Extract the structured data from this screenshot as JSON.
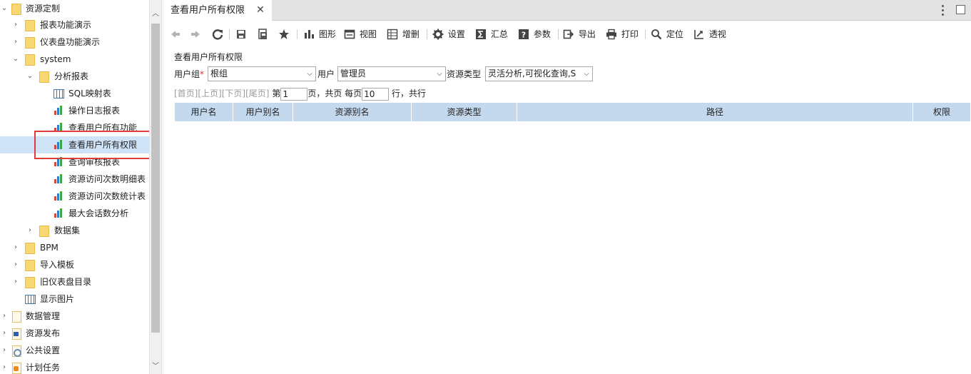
{
  "tree": {
    "items": [
      {
        "label": "资源定制",
        "icon": "folder-icon",
        "expanded": true
      },
      {
        "label": "报表功能演示",
        "icon": "folder-icon",
        "expanded": false
      },
      {
        "label": "仪表盘功能演示",
        "icon": "folder-icon",
        "expanded": false
      },
      {
        "label": "system",
        "icon": "folder-icon",
        "expanded": true
      },
      {
        "label": "分析报表",
        "icon": "folder-icon",
        "expanded": true
      },
      {
        "label": "SQL映射表",
        "icon": "grid-icon"
      },
      {
        "label": "操作日志报表",
        "icon": "bar-chart-icon"
      },
      {
        "label": "查看用户所有功能",
        "icon": "bar-chart-icon"
      },
      {
        "label": "查看用户所有权限",
        "icon": "bar-chart-icon",
        "selected": true
      },
      {
        "label": "查询审核报表",
        "icon": "bar-chart-icon"
      },
      {
        "label": "资源访问次数明细表",
        "icon": "bar-chart-icon"
      },
      {
        "label": "资源访问次数统计表",
        "icon": "bar-chart-icon"
      },
      {
        "label": "最大会话数分析",
        "icon": "bar-chart-icon"
      },
      {
        "label": "数据集",
        "icon": "folder-icon",
        "expanded": false
      },
      {
        "label": "BPM",
        "icon": "folder-icon",
        "expanded": false
      },
      {
        "label": "导入模板",
        "icon": "folder-icon",
        "expanded": false
      },
      {
        "label": "旧仪表盘目录",
        "icon": "folder-icon",
        "expanded": false
      },
      {
        "label": "显示图片",
        "icon": "grid-icon"
      },
      {
        "label": "数据管理",
        "icon": "page-icon",
        "expanded": false
      },
      {
        "label": "资源发布",
        "icon": "page-publish-icon",
        "expanded": false
      },
      {
        "label": "公共设置",
        "icon": "page-settings-icon",
        "expanded": false
      },
      {
        "label": "计划任务",
        "icon": "page-schedule-icon",
        "expanded": false
      }
    ]
  },
  "tab": {
    "title": "查看用户所有权限",
    "close": "✕"
  },
  "toolbar": {
    "chart": "图形",
    "view": "视图",
    "add_delete": "增删",
    "settings": "设置",
    "summary": "汇总",
    "params": "参数",
    "export": "导出",
    "print": "打印",
    "locate": "定位",
    "pivot": "透视"
  },
  "form": {
    "title": "查看用户所有权限",
    "group_label": "用户组",
    "required_mark": "*",
    "group_value": "根组",
    "user_label": "用户",
    "user_value": "管理员",
    "type_label": "资源类型",
    "type_value": "灵活分析,可视化查询,S"
  },
  "pager": {
    "first": "[首页]",
    "prev": "[上页]",
    "next": "[下页]",
    "last": "[尾页]",
    "page_prefix": "第",
    "page_value": "1",
    "page_suffix": "页，共页 每页",
    "size_value": "10",
    "size_suffix": "行，共行"
  },
  "table": {
    "columns": [
      "用户名",
      "用户别名",
      "资源别名",
      "资源类型",
      "路径",
      "权限"
    ]
  },
  "colors": {
    "selected_row": "#cfe3f7",
    "highlight_border": "#e03c3c",
    "table_header": "#c5d9ee",
    "required": "#e0302f"
  }
}
